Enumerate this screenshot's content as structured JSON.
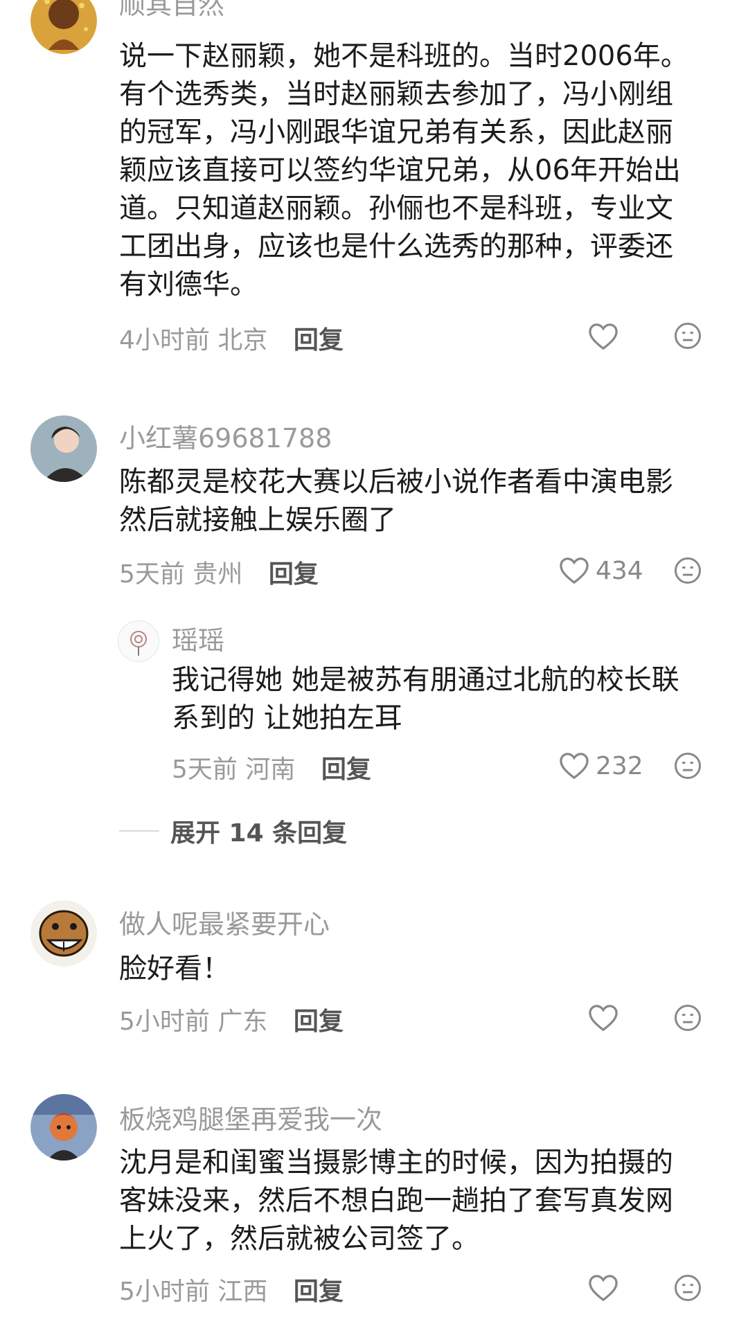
{
  "comments": [
    {
      "username": "顺其自然",
      "lines": [
        "说一下赵丽颖，她不是科班的。当时2006年。",
        "有个选秀类，当时赵丽颖去参加了，冯小刚组",
        "的冠军，冯小刚跟华谊兄弟有关系，因此赵丽",
        "颖应该直接可以签约华谊兄弟，从06年开始出",
        "道。只知道赵丽颖。孙俪也不是科班，专业文",
        "工团出身，应该也是什么选秀的那种，评委还",
        "有刘德华。"
      ],
      "time": "4小时前",
      "location": "北京",
      "reply_label": "回复",
      "likes": ""
    },
    {
      "username": "小红薯69681788",
      "lines": [
        "陈都灵是校花大赛以后被小说作者看中演电影",
        "然后就接触上娱乐圈了"
      ],
      "time": "5天前",
      "location": "贵州",
      "reply_label": "回复",
      "likes": "434"
    },
    {
      "username": "瑶瑶",
      "lines": [
        "我记得她  她是被苏有朋通过北航的校长联",
        "系到的  让她拍左耳"
      ],
      "time": "5天前",
      "location": "河南",
      "reply_label": "回复",
      "likes": "232"
    },
    {
      "username": "做人呢最紧要开心",
      "lines": [
        "脸好看！"
      ],
      "time": "5小时前",
      "location": "广东",
      "reply_label": "回复",
      "likes": ""
    },
    {
      "username": "板烧鸡腿堡再爱我一次",
      "lines": [
        "沈月是和闺蜜当摄影博主的时候，因为拍摄的",
        "客妹没来，然后不想白跑一趟拍了套写真发网",
        "上火了，然后就被公司签了。"
      ],
      "time": "5小时前",
      "location": "江西",
      "reply_label": "回复",
      "likes": ""
    }
  ],
  "expand_replies": "展开 14 条回复",
  "icons": {
    "like": "heart-icon",
    "dislike": "dislike-face-icon"
  },
  "colors": {
    "meta_gray": "#9a9a9a",
    "text": "#1b1b1b",
    "reply": "#555555"
  }
}
